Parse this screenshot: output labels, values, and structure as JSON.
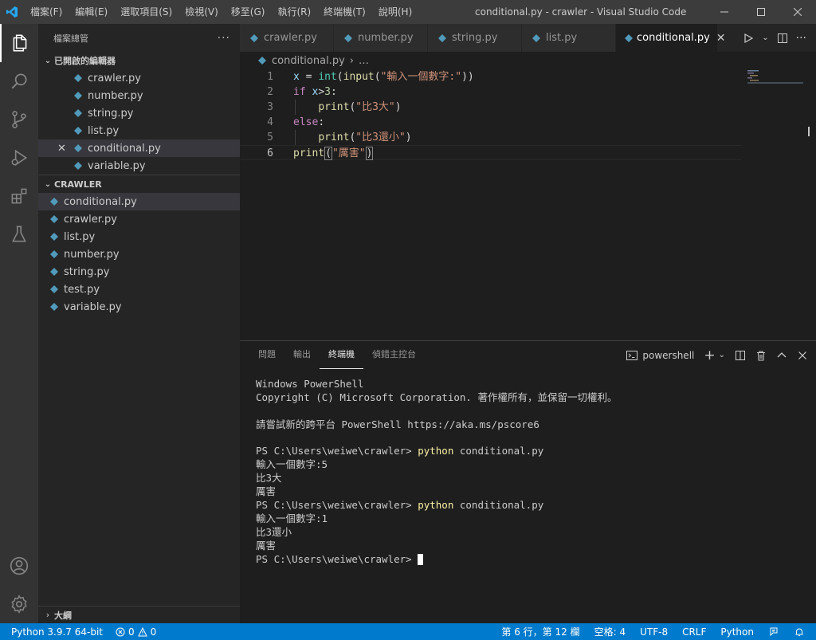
{
  "titlebar": {
    "menus": [
      "檔案(F)",
      "編輯(E)",
      "選取項目(S)",
      "檢視(V)",
      "移至(G)",
      "執行(R)",
      "終端機(T)",
      "說明(H)"
    ],
    "title": "conditional.py - crawler - Visual Studio Code"
  },
  "sidebar": {
    "title": "檔案總管",
    "open_editors_header": "已開啟的編輯器",
    "open_editors": [
      "crawler.py",
      "number.py",
      "string.py",
      "list.py",
      "conditional.py",
      "variable.py"
    ],
    "workspace_header": "CRAWLER",
    "files": [
      "conditional.py",
      "crawler.py",
      "list.py",
      "number.py",
      "string.py",
      "test.py",
      "variable.py"
    ],
    "outline_header": "大綱"
  },
  "tabs": [
    "crawler.py",
    "number.py",
    "string.py",
    "list.py",
    "conditional.py"
  ],
  "breadcrumb": {
    "file": "conditional.py",
    "rest": "…"
  },
  "editor": {
    "line_numbers": [
      "1",
      "2",
      "3",
      "4",
      "5",
      "6"
    ],
    "lines": [
      [
        {
          "t": "x",
          "c": "var"
        },
        {
          "t": " = ",
          "c": "op"
        },
        {
          "t": "int",
          "c": "bi"
        },
        {
          "t": "(",
          "c": "op"
        },
        {
          "t": "input",
          "c": "fn"
        },
        {
          "t": "(",
          "c": "op"
        },
        {
          "t": "\"輸入一個數字:\"",
          "c": "str"
        },
        {
          "t": "))",
          "c": "op"
        }
      ],
      [
        {
          "t": "if",
          "c": "kw"
        },
        {
          "t": " ",
          "c": "op"
        },
        {
          "t": "x",
          "c": "var"
        },
        {
          "t": ">",
          "c": "op"
        },
        {
          "t": "3",
          "c": "num"
        },
        {
          "t": ":",
          "c": "op"
        }
      ],
      [
        {
          "t": "    ",
          "c": "op"
        },
        {
          "t": "print",
          "c": "fn"
        },
        {
          "t": "(",
          "c": "op"
        },
        {
          "t": "\"比3大\"",
          "c": "str"
        },
        {
          "t": ")",
          "c": "op"
        }
      ],
      [
        {
          "t": "else",
          "c": "kw"
        },
        {
          "t": ":",
          "c": "op"
        }
      ],
      [
        {
          "t": "    ",
          "c": "op"
        },
        {
          "t": "print",
          "c": "fn"
        },
        {
          "t": "(",
          "c": "op"
        },
        {
          "t": "\"比3還小\"",
          "c": "str"
        },
        {
          "t": ")",
          "c": "op"
        }
      ],
      [
        {
          "t": "print",
          "c": "fn"
        },
        {
          "t": "(",
          "c": "op",
          "box": true
        },
        {
          "t": "\"厲害\"",
          "c": "str"
        },
        {
          "t": ")",
          "c": "op",
          "box": true
        }
      ]
    ],
    "current_line": 6
  },
  "panel": {
    "tabs": [
      "問題",
      "輸出",
      "終端機",
      "偵錯主控台"
    ],
    "active_tab": "終端機",
    "shell": "powershell"
  },
  "terminal": {
    "lines": [
      {
        "text": "Windows PowerShell"
      },
      {
        "text": "Copyright (C) Microsoft Corporation. 著作權所有，並保留一切權利。"
      },
      {
        "text": ""
      },
      {
        "text": "請嘗試新的跨平台 PowerShell https://aka.ms/pscore6"
      },
      {
        "text": ""
      },
      {
        "text": "PS C:\\Users\\weiwe\\crawler> ",
        "cmd": "python",
        "args": " conditional.py"
      },
      {
        "text": "輸入一個數字:5"
      },
      {
        "text": "比3大"
      },
      {
        "text": "厲害"
      },
      {
        "text": "PS C:\\Users\\weiwe\\crawler> ",
        "cmd": "python",
        "args": " conditional.py"
      },
      {
        "text": "輸入一個數字:1"
      },
      {
        "text": "比3還小"
      },
      {
        "text": "厲害"
      },
      {
        "text": "PS C:\\Users\\weiwe\\crawler> ",
        "cursor": true
      }
    ]
  },
  "statusbar": {
    "interpreter": "Python 3.9.7 64-bit",
    "errors": "0",
    "warnings": "0",
    "position": "第 6 行，第 12 欄",
    "spaces": "空格: 4",
    "encoding": "UTF-8",
    "eol": "CRLF",
    "language": "Python"
  },
  "colors": {
    "accent": "#007acc",
    "python_icon": "#519aba",
    "activity_icon": "#858585"
  }
}
